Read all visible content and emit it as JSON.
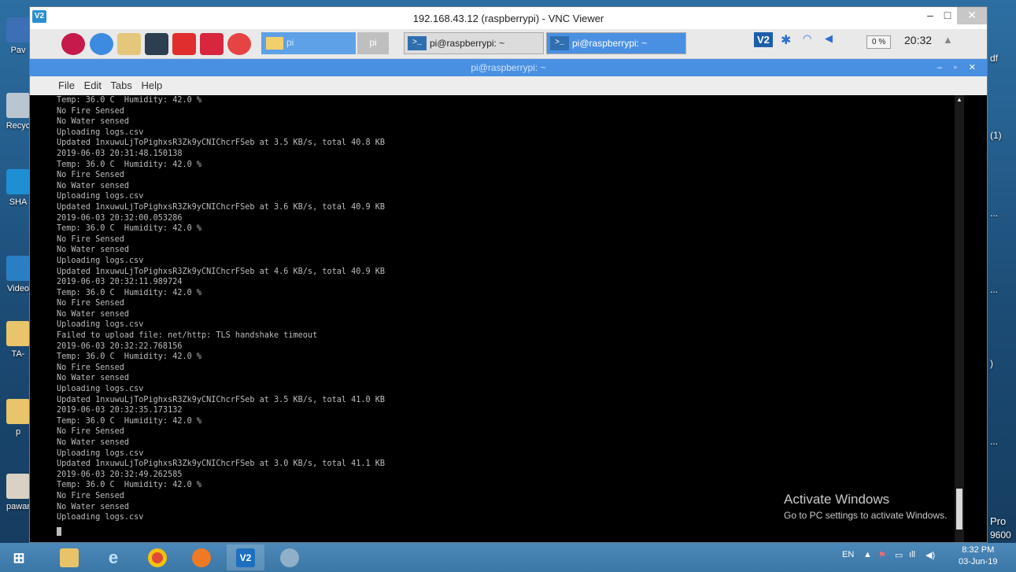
{
  "desktop": {
    "icons": [
      {
        "label": "Pav"
      },
      {
        "label": "Recyc"
      },
      {
        "label": "SHA"
      },
      {
        "label": "Video"
      },
      {
        "label": "TA-"
      },
      {
        "label": "p"
      },
      {
        "label": "pawar"
      }
    ],
    "right_texts": [
      "df",
      "(1)",
      "...",
      "...",
      ")",
      "...",
      "Pro",
      "9600"
    ]
  },
  "vnc": {
    "title": "192.168.43.12 (raspberrypi) - VNC Viewer",
    "logo": "V2",
    "min": "–",
    "max": "□",
    "close": "✕"
  },
  "pi_panel": {
    "folder_label": "pi",
    "folder_tab": "pi",
    "tasks": [
      "pi@raspberrypi: ~",
      "pi@raspberrypi: ~"
    ],
    "task_icon": ">_",
    "vnc_tray": "V2",
    "cpu": "0 %",
    "time": "20:32",
    "eject": "▲"
  },
  "terminal": {
    "title": "pi@raspberrypi: ~",
    "controls": "– ▫ ✕",
    "menu": [
      "File",
      "Edit",
      "Tabs",
      "Help"
    ],
    "lines": [
      "Temp: 36.0 C  Humidity: 42.0 %",
      "No Fire Sensed",
      "No Water sensed",
      "Uploading logs.csv",
      "Updated 1nxuwuLjToPighxsR3Zk9yCNIChcrFSeb at 3.5 KB/s, total 40.8 KB",
      "2019-06-03 20:31:48.150138",
      "Temp: 36.0 C  Humidity: 42.0 %",
      "No Fire Sensed",
      "No Water sensed",
      "Uploading logs.csv",
      "Updated 1nxuwuLjToPighxsR3Zk9yCNIChcrFSeb at 3.6 KB/s, total 40.9 KB",
      "2019-06-03 20:32:00.053286",
      "Temp: 36.0 C  Humidity: 42.0 %",
      "No Fire Sensed",
      "No Water sensed",
      "Uploading logs.csv",
      "Updated 1nxuwuLjToPighxsR3Zk9yCNIChcrFSeb at 4.6 KB/s, total 40.9 KB",
      "2019-06-03 20:32:11.989724",
      "Temp: 36.0 C  Humidity: 42.0 %",
      "No Fire Sensed",
      "No Water sensed",
      "Uploading logs.csv",
      "Failed to upload file: net/http: TLS handshake timeout",
      "2019-06-03 20:32:22.768156",
      "Temp: 36.0 C  Humidity: 42.0 %",
      "No Fire Sensed",
      "No Water sensed",
      "Uploading logs.csv",
      "Updated 1nxuwuLjToPighxsR3Zk9yCNIChcrFSeb at 3.5 KB/s, total 41.0 KB",
      "2019-06-03 20:32:35.173132",
      "Temp: 36.0 C  Humidity: 42.0 %",
      "No Fire Sensed",
      "No Water sensed",
      "Uploading logs.csv",
      "Updated 1nxuwuLjToPighxsR3Zk9yCNIChcrFSeb at 3.0 KB/s, total 41.1 KB",
      "2019-06-03 20:32:49.262585",
      "Temp: 36.0 C  Humidity: 42.0 %",
      "No Fire Sensed",
      "No Water sensed",
      "Uploading logs.csv"
    ]
  },
  "activate_windows": {
    "title": "Activate Windows",
    "subtitle": "Go to PC settings to activate Windows."
  },
  "taskbar": {
    "vnc_label": "V2",
    "lang": "EN",
    "time": "8:32 PM",
    "date": "03-Jun-19"
  },
  "colors": {
    "terminal_bg": "#000000",
    "terminal_fg": "#bdbdbd",
    "pi_accent": "#4a90e2",
    "taskbar": "#3a76a6"
  }
}
